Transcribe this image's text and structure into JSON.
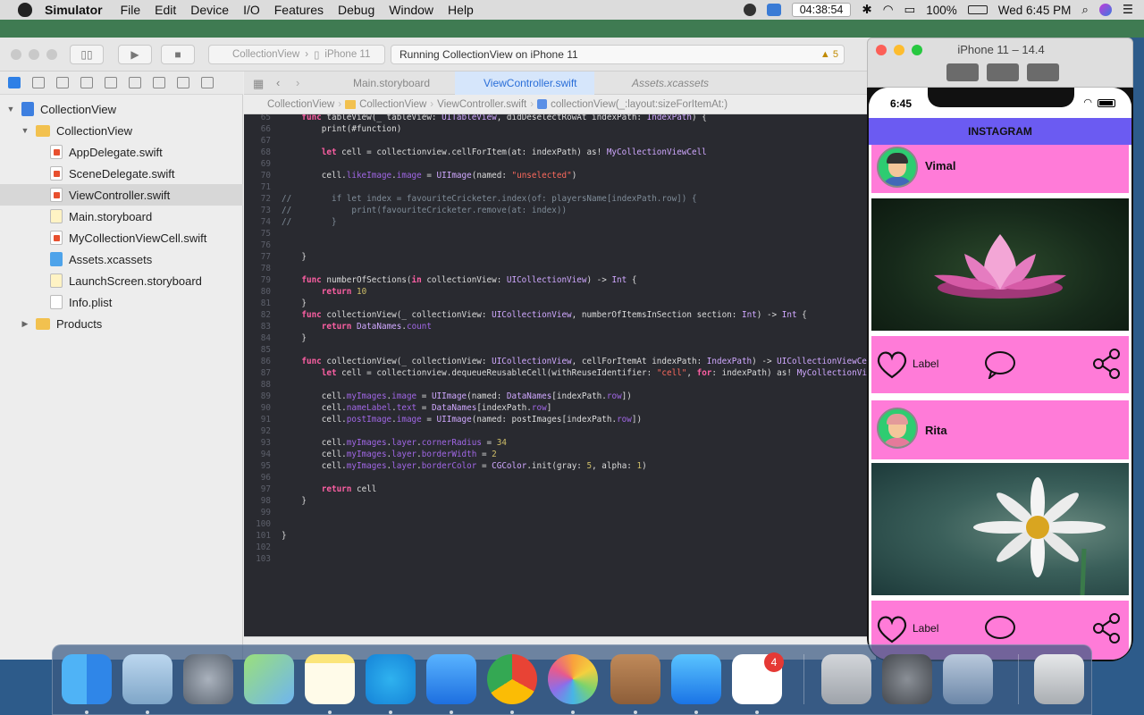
{
  "menubar": {
    "app_name": "Simulator",
    "items": [
      "File",
      "Edit",
      "Device",
      "I/O",
      "Features",
      "Debug",
      "Window",
      "Help"
    ],
    "clock": "04:38:54",
    "battery": "100%",
    "datetime": "Wed 6:45 PM"
  },
  "toolbar": {
    "scheme_project": "CollectionView",
    "scheme_device": "iPhone 11",
    "activity": "Running CollectionView on iPhone 11",
    "warning_count": "5"
  },
  "navigator": {
    "items": [
      {
        "label": "CollectionView",
        "indent": 0,
        "icon": "xcode-project-icon"
      },
      {
        "label": "CollectionView",
        "indent": 1,
        "icon": "folder-icon"
      },
      {
        "label": "AppDelegate.swift",
        "indent": 2,
        "icon": "swift-file-icon"
      },
      {
        "label": "SceneDelegate.swift",
        "indent": 2,
        "icon": "swift-file-icon"
      },
      {
        "label": "ViewController.swift",
        "indent": 2,
        "icon": "swift-file-icon",
        "selected": true
      },
      {
        "label": "Main.storyboard",
        "indent": 2,
        "icon": "storyboard-icon"
      },
      {
        "label": "MyCollectionViewCell.swift",
        "indent": 2,
        "icon": "swift-file-icon"
      },
      {
        "label": "Assets.xcassets",
        "indent": 2,
        "icon": "assets-icon"
      },
      {
        "label": "LaunchScreen.storyboard",
        "indent": 2,
        "icon": "storyboard-icon"
      },
      {
        "label": "Info.plist",
        "indent": 2,
        "icon": "plist-icon"
      },
      {
        "label": "Products",
        "indent": 1,
        "icon": "folder-icon"
      }
    ]
  },
  "tabs": [
    "Main.storyboard",
    "ViewController.swift",
    "Assets.xcassets"
  ],
  "jumpbar": [
    "CollectionView",
    "CollectionView",
    "ViewController.swift",
    "collectionView(_:layout:sizeForItemAt:)"
  ],
  "code": [
    {
      "n": "65",
      "t": "    func tableView(_ tableView: UITableView, didDeselectRowAt indexPath: IndexPath) {"
    },
    {
      "n": "66",
      "t": "        print(#function)"
    },
    {
      "n": "67",
      "t": ""
    },
    {
      "n": "68",
      "t": "        let cell = collectionview.cellForItem(at: indexPath) as! MyCollectionViewCell"
    },
    {
      "n": "69",
      "t": ""
    },
    {
      "n": "70",
      "t": "        cell.likeImage.image = UIImage(named: \"unselected\")"
    },
    {
      "n": "71",
      "t": ""
    },
    {
      "n": "72",
      "t": "//        if let index = favouriteCricketer.index(of: playersName[indexPath.row]) {"
    },
    {
      "n": "73",
      "t": "//            print(favouriteCricketer.remove(at: index))"
    },
    {
      "n": "74",
      "t": "//        }"
    },
    {
      "n": "75",
      "t": ""
    },
    {
      "n": "76",
      "t": ""
    },
    {
      "n": "77",
      "t": "    }"
    },
    {
      "n": "78",
      "t": ""
    },
    {
      "n": "79",
      "t": "    func numberOfSections(in collectionView: UICollectionView) -> Int {"
    },
    {
      "n": "80",
      "t": "        return 10"
    },
    {
      "n": "81",
      "t": "    }"
    },
    {
      "n": "82",
      "t": "    func collectionView(_ collectionView: UICollectionView, numberOfItemsInSection section: Int) -> Int {"
    },
    {
      "n": "83",
      "t": "        return DataNames.count"
    },
    {
      "n": "84",
      "t": "    }"
    },
    {
      "n": "85",
      "t": ""
    },
    {
      "n": "86",
      "t": "    func collectionView(_ collectionView: UICollectionView, cellForItemAt indexPath: IndexPath) -> UICollectionViewCel"
    },
    {
      "n": "87",
      "t": "        let cell = collectionview.dequeueReusableCell(withReuseIdentifier: \"cell\", for: indexPath) as! MyCollectionVie"
    },
    {
      "n": "88",
      "t": ""
    },
    {
      "n": "89",
      "t": "        cell.myImages.image = UIImage(named: DataNames[indexPath.row])"
    },
    {
      "n": "90",
      "t": "        cell.nameLabel.text = DataNames[indexPath.row]"
    },
    {
      "n": "91",
      "t": "        cell.postImage.image = UIImage(named: postImages[indexPath.row])"
    },
    {
      "n": "92",
      "t": ""
    },
    {
      "n": "93",
      "t": "        cell.myImages.layer.cornerRadius = 34"
    },
    {
      "n": "94",
      "t": "        cell.myImages.layer.borderWidth = 2"
    },
    {
      "n": "95",
      "t": "        cell.myImages.layer.borderColor = CGColor.init(gray: 5, alpha: 1)"
    },
    {
      "n": "96",
      "t": ""
    },
    {
      "n": "97",
      "t": "        return cell"
    },
    {
      "n": "98",
      "t": "    }"
    },
    {
      "n": "99",
      "t": ""
    },
    {
      "n": "100",
      "t": ""
    },
    {
      "n": "101",
      "t": "}"
    },
    {
      "n": "102",
      "t": ""
    },
    {
      "n": "103",
      "t": ""
    }
  ],
  "simulator": {
    "title": "iPhone 11 – 14.4",
    "status_time": "6:45",
    "nav_title": "INSTAGRAM",
    "posts": [
      {
        "name": "Vimal",
        "action_label": "Label",
        "avatar": "man-avatar-icon",
        "photo": "lotus-photo"
      },
      {
        "name": "Rita",
        "action_label": "Label",
        "avatar": "woman-avatar-icon",
        "photo": "daisy-photo"
      }
    ]
  },
  "dock": {
    "apps": [
      "finder-icon",
      "preview-eagle-icon",
      "launchpad-icon",
      "maps-icon",
      "notes-icon",
      "skype-icon",
      "xcode-icon",
      "chrome-icon",
      "photos-icon",
      "contacts-icon",
      "app-store-icon",
      "reminders-icon",
      "screen-capture-icon",
      "system-preferences-icon",
      "image-preview-icon",
      "trash-icon"
    ],
    "reminders_badge": "4"
  },
  "colors": {
    "nav_bar": "#6b5bf2",
    "cell_pink": "#ff7bd8",
    "editor_bg": "#292a30"
  }
}
